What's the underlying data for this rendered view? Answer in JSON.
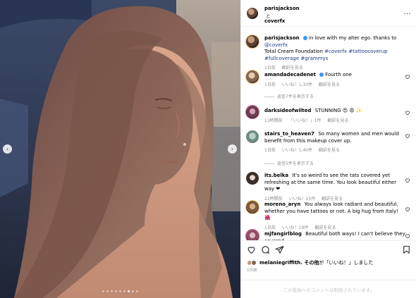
{
  "header": {
    "username": "parisjackson",
    "connector": "と",
    "collaborator": "coverfx",
    "more_icon": "…"
  },
  "caption": {
    "username": "parisjackson",
    "text_a": "in love with my alter ego. thanks to ",
    "mention": "@coverfx",
    "text_b": "Total Cream Foundation ",
    "tags": "#coverfx #tattoocoverup #fullcoverage #grammys",
    "time": "1日前",
    "translate": "翻訳を見る"
  },
  "comments": [
    {
      "username": "amandadecadenet",
      "text": "Fourth one",
      "time": "1日前",
      "likes": "いいね！1,33件",
      "translate": "翻訳を見る",
      "replies": "返信7件を表示する"
    },
    {
      "username": "darksideofwilted",
      "text": "STUNNING 😍 😡 ✨",
      "time": "13時間前",
      "likes": "「いいね！」1件",
      "translate": "翻訳を見る"
    },
    {
      "username": "stairs_to_heaven7",
      "text": "So many women and men would benefit from this makeup cover up.",
      "time": "1日前",
      "likes": "いいね！1,40件",
      "translate": "翻訳を見る",
      "replies": "返信5件を表示する"
    },
    {
      "username": "its.belka",
      "text": "It's so weird to see the tats covered yet refreshing at the same time. You look beautiful either way ❤",
      "time": "22時間前",
      "likes": "いいね！15件",
      "translate": "翻訳を見る"
    },
    {
      "username": "moreno_aryn",
      "text": "You always look radiant and beautiful, whether you have tattoos or not. A big hug from Italy! 🌺",
      "time": "1日前",
      "likes": "いいね！19件",
      "translate": "翻訳を見る"
    },
    {
      "username": "mjfangirlblog",
      "text": "Beautiful both ways! I can't believe they covered"
    }
  ],
  "likes_line": {
    "username": "melaniegriffith.",
    "text_a": " その他",
    "text_b": "が「いいね！」しました"
  },
  "post_date": "1日前",
  "comments_closed": "この投稿へのコメントは制限されています。",
  "carousel": {
    "total": 9,
    "active": 7
  },
  "colors": {
    "link": "#1e3a8a",
    "verified": "#3897f0",
    "meta": "#8e8e8e"
  }
}
